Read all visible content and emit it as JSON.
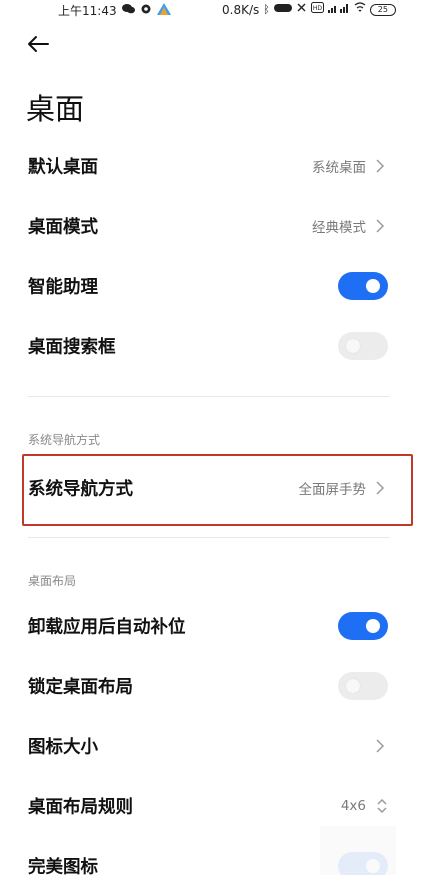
{
  "status_bar": {
    "time": "上午11:43",
    "network_speed": "0.8K/s",
    "battery": "25",
    "icons": [
      "wechat-icon",
      "gear-icon",
      "app-icon",
      "bluetooth-icon",
      "mute-icon",
      "hd-icon",
      "signal-icon",
      "wifi-icon"
    ]
  },
  "header": {
    "title": "桌面"
  },
  "settings": {
    "default_desktop": {
      "label": "默认桌面",
      "value": "系统桌面"
    },
    "desktop_mode": {
      "label": "桌面模式",
      "value": "经典模式"
    },
    "smart_assistant": {
      "label": "智能助理",
      "enabled": true
    },
    "desktop_search": {
      "label": "桌面搜索框",
      "enabled": false
    }
  },
  "nav_section": {
    "header": "系统导航方式",
    "nav_method": {
      "label": "系统导航方式",
      "value": "全面屏手势"
    }
  },
  "layout_section": {
    "header": "桌面布局",
    "auto_fill": {
      "label": "卸载应用后自动补位",
      "enabled": true
    },
    "lock_layout": {
      "label": "锁定桌面布局",
      "enabled": false
    },
    "icon_size": {
      "label": "图标大小"
    },
    "layout_rule": {
      "label": "桌面布局规则",
      "value": "4x6"
    },
    "perfect_icons": {
      "label": "完美图标",
      "enabled": true
    }
  },
  "colors": {
    "accent": "#1f6ff5",
    "highlight_border": "#c0392b"
  }
}
